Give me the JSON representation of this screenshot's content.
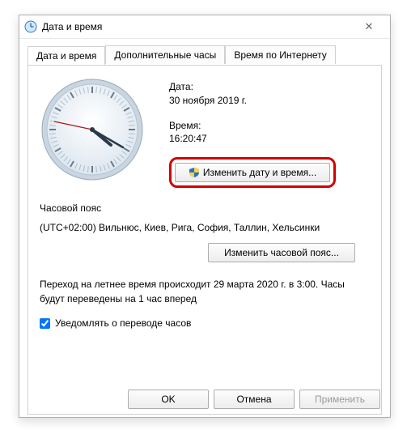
{
  "window": {
    "title": "Дата и время"
  },
  "tabs": [
    "Дата и время",
    "Дополнительные часы",
    "Время по Интернету"
  ],
  "main": {
    "date_label": "Дата:",
    "date_value": "30 ноября 2019 г.",
    "time_label": "Время:",
    "time_value": "16:20:47",
    "change_datetime": "Изменить дату и время...",
    "timezone_label": "Часовой пояс",
    "timezone_value": "(UTC+02:00) Вильнюс, Киев, Рига, София, Таллин, Хельсинки",
    "change_timezone": "Изменить часовой пояс...",
    "dst_text": "Переход на летнее время происходит 29 марта 2020 г. в 3:00. Часы будут переведены на 1 час вперед",
    "notify_label": "Уведомлять о переводе часов"
  },
  "buttons": {
    "ok": "OK",
    "cancel": "Отмена",
    "apply": "Применить"
  },
  "clock": {
    "hour": 4,
    "minute": 20,
    "second": 47
  }
}
